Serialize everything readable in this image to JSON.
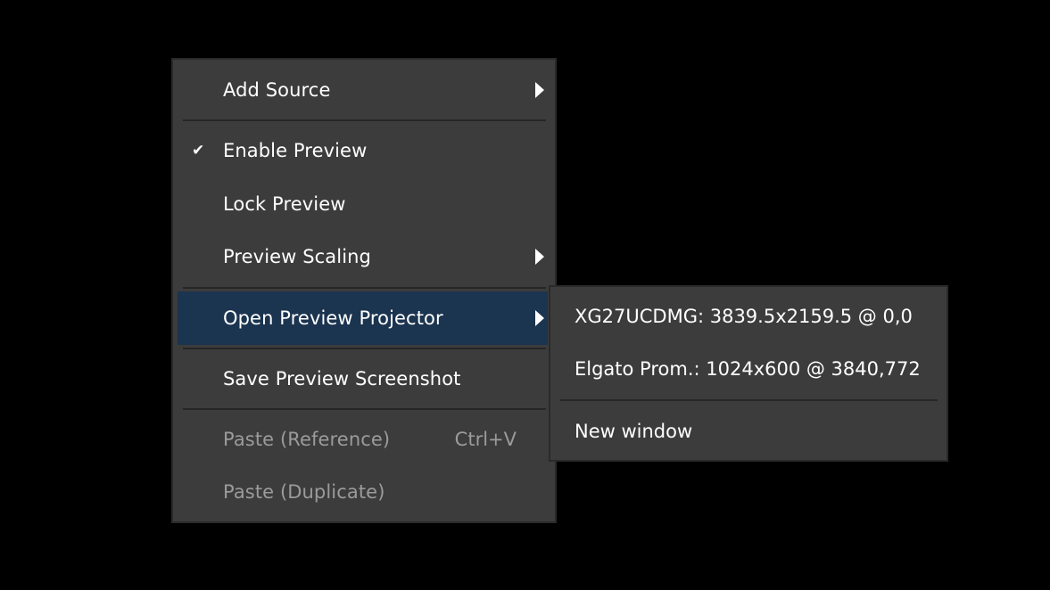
{
  "context_menu": {
    "items": [
      {
        "label": "Add Source",
        "has_submenu": true
      },
      {
        "label": "Enable Preview",
        "checked": true
      },
      {
        "label": "Lock Preview"
      },
      {
        "label": "Preview Scaling",
        "has_submenu": true
      },
      {
        "label": "Open Preview Projector",
        "has_submenu": true,
        "highlighted": true
      },
      {
        "label": "Save Preview Screenshot"
      },
      {
        "label": "Paste (Reference)",
        "shortcut": "Ctrl+V",
        "disabled": true
      },
      {
        "label": "Paste (Duplicate)",
        "disabled": true
      }
    ],
    "check_glyph": "✔"
  },
  "projector_submenu": {
    "items": [
      {
        "label": "XG27UCDMG: 3839.5x2159.5 @ 0,0"
      },
      {
        "label": "Elgato Prom.: 1024x600 @ 3840,772"
      },
      {
        "label": "New window"
      }
    ]
  },
  "colors": {
    "background": "#000000",
    "menu_bg": "#3c3c3c",
    "highlight": "#1b344f",
    "disabled_text": "#9b9b9b"
  }
}
